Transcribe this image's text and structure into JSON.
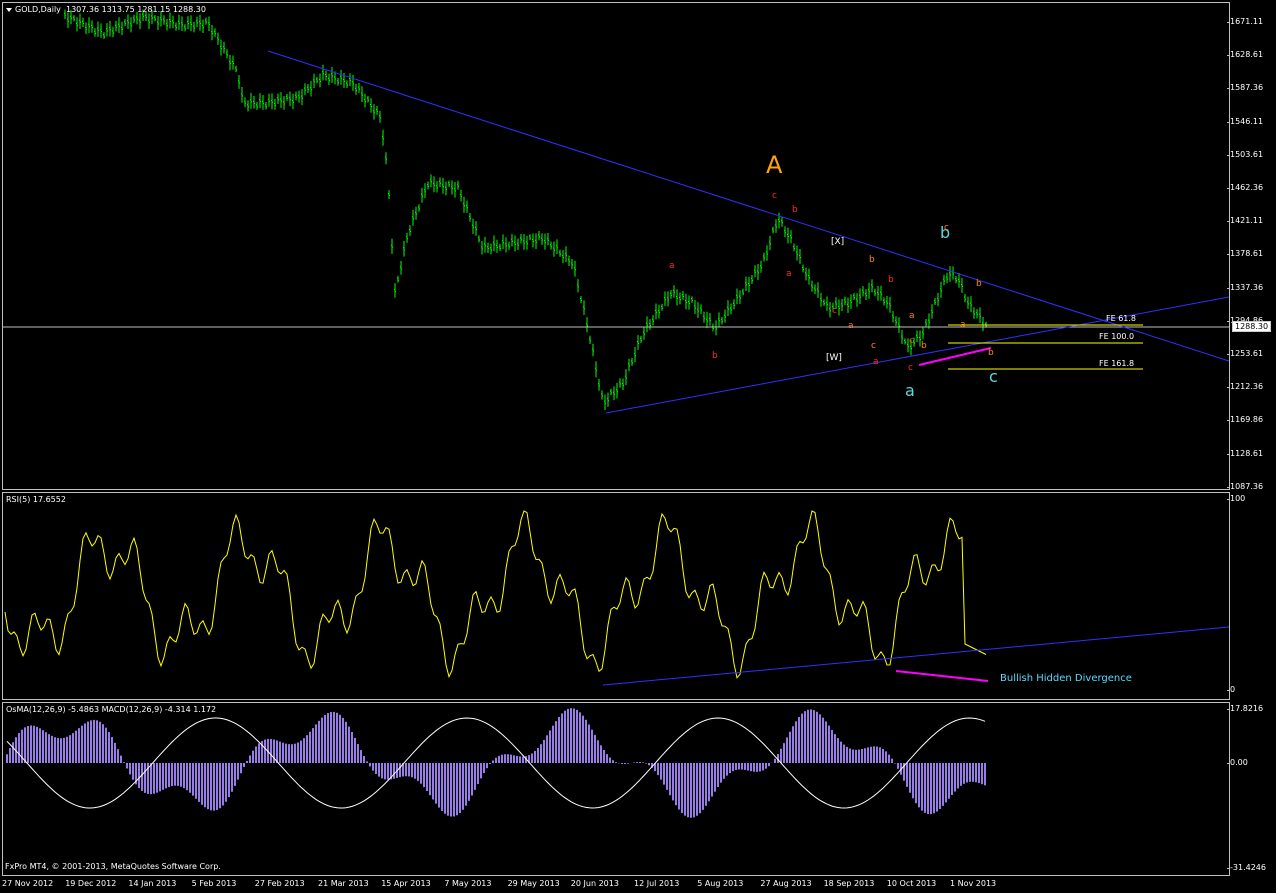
{
  "header": {
    "symbol_label": "GOLD,Daily",
    "ohlc": "1307.36 1313.75 1281.15 1288.30"
  },
  "current_price": "1288.30",
  "price_scale": [
    "1671.11",
    "1628.61",
    "1587.36",
    "1546.11",
    "1503.61",
    "1462.36",
    "1421.11",
    "1378.61",
    "1337.36",
    "1294.86",
    "1253.61",
    "1212.36",
    "1169.86",
    "1128.61",
    "1087.36"
  ],
  "rsi": {
    "label": "RSI(5) 17.6552",
    "scale_top": "100",
    "scale_bottom": "0"
  },
  "osma": {
    "label": "OsMA(12,26,9) -5.4863  MACD(12,26,9) -4.314 1.172",
    "scale": [
      "17.8216",
      "0.00",
      "-31.4246"
    ]
  },
  "time_axis": [
    "27 Nov 2012",
    "19 Dec 2012",
    "14 Jan 2013",
    "5 Feb 2013",
    "27 Feb 2013",
    "21 Mar 2013",
    "15 Apr 2013",
    "7 May 2013",
    "29 May 2013",
    "20 Jun 2013",
    "12 Jul 2013",
    "5 Aug 2013",
    "27 Aug 2013",
    "18 Sep 2013",
    "10 Oct 2013",
    "1 Nov 2013"
  ],
  "footer": "FxPro MT4, © 2001-2013, MetaQuotes Software Corp.",
  "waves": {
    "A": "A",
    "b_major": "b",
    "a_major": "a",
    "c_major": "c",
    "W": "[W]",
    "X": "[X]",
    "small": [
      "a",
      "b",
      "c",
      "b",
      "a",
      "c",
      "b",
      "a",
      "c",
      "b",
      "c",
      "a",
      "b",
      "c",
      "a",
      "b",
      "c",
      "a",
      "b",
      "c",
      "b",
      "a",
      "c"
    ]
  },
  "fib_levels": [
    "FE 61.8",
    "FE 100.0",
    "FE 161.8"
  ],
  "divergence_note": "Bullish Hidden Divergence",
  "colors": {
    "bars": "#00ff00",
    "trendline": "#3030ff",
    "rsi": "#ffff00",
    "osma": "#9a7ce8",
    "macd": "#ffffff",
    "divergence": "#ff00ff",
    "major_wave": "#ffa500",
    "cyan_wave": "#5fd8d8",
    "red_wave": "#ff3020",
    "orange_wave": "#ff8c00"
  }
}
